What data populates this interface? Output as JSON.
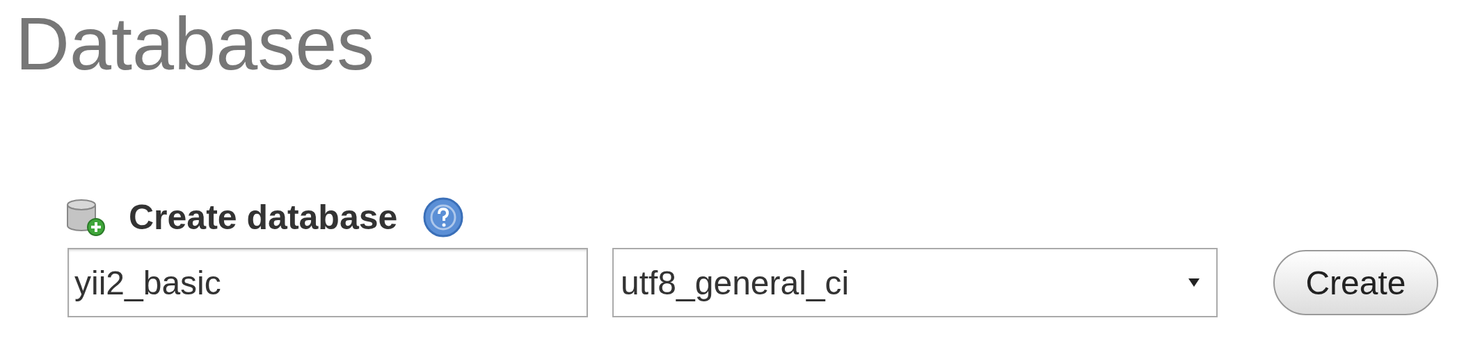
{
  "page_title": "Databases",
  "create_database": {
    "label": "Create database",
    "name_field": {
      "value": "yii2_basic"
    },
    "collation_select": {
      "value": "utf8_general_ci"
    },
    "button": "Create"
  }
}
